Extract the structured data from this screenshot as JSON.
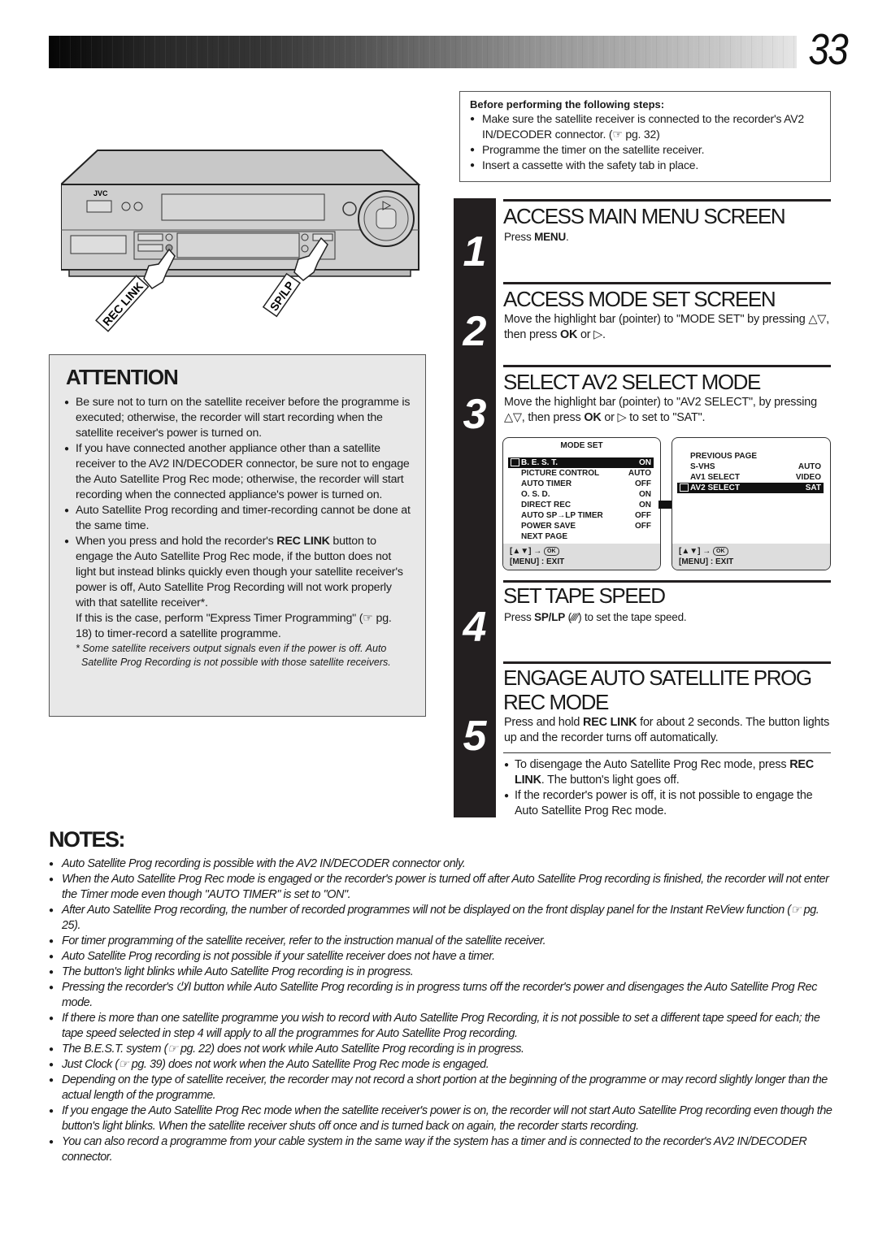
{
  "header": {
    "page_number": "33"
  },
  "illustration": {
    "brand": "JVC",
    "power_button_label": "⏻/I",
    "rec_link_label": "REC LINK",
    "sp_lp_label": "SP/LP"
  },
  "before": {
    "title": "Before performing the following steps:",
    "items": [
      "Make sure the satellite receiver is connected to the recorder's AV2 IN/DECODER connector. (☞ pg. 32)",
      "Programme the timer on the satellite receiver.",
      "Insert a cassette with the safety tab in place."
    ]
  },
  "attention": {
    "title": "ATTENTION",
    "items": [
      "Be sure not to turn on the satellite receiver before the programme is executed; otherwise, the recorder will start recording when the satellite receiver's power is turned on.",
      "If you have connected another appliance other than a satellite receiver to the AV2 IN/DECODER connector, be sure not to engage the Auto Satellite Prog Rec mode; otherwise, the recorder will start recording when the connected appliance's power is turned on.",
      "Auto Satellite Prog recording and timer-recording cannot be done at the same time."
    ],
    "item4_pre": "When you press and hold the recorder's ",
    "item4_bold": "REC LINK",
    "item4_post": " button to engage the Auto Satellite Prog Rec mode, if the button does not light but instead blinks quickly even though your satellite receiver's power is off, Auto Satellite Prog Recording will not work properly with that satellite receiver*.",
    "extra": "If this is the case, perform \"Express Timer Programming\" (☞ pg. 18) to timer-record a satellite programme.",
    "footnote": "* Some satellite receivers output signals even if the power is off. Auto Satellite Prog Recording is not possible with those satellite receivers."
  },
  "steps": [
    {
      "number": "1",
      "title": "ACCESS MAIN MENU SCREEN",
      "text_pre": "Press ",
      "text_bold": "MENU",
      "text_post": "."
    },
    {
      "number": "2",
      "title": "ACCESS MODE SET SCREEN",
      "text_pre": "Move the highlight bar (pointer) to \"MODE SET\" by pressing △▽, then press ",
      "text_bold": "OK",
      "text_post": " or ▷."
    },
    {
      "number": "3",
      "title": "SELECT AV2 SELECT MODE",
      "text_pre": "Move the highlight bar (pointer) to \"AV2 SELECT\", by pressing △▽, then press ",
      "text_bold": "OK",
      "text_post": " or ▷ to set to \"SAT\"."
    },
    {
      "number": "4",
      "title": "SET TAPE SPEED",
      "text_pre": "Press ",
      "text_bold": "SP/LP",
      "text_post": " (∕∕∕∕) to set the tape speed."
    },
    {
      "number": "5",
      "title": "ENGAGE AUTO SATELLITE PROG REC MODE",
      "text_pre": "Press and hold ",
      "text_bold": "REC LINK",
      "text_post": " for about 2 seconds. The button lights up and the recorder turns off automatically.",
      "bullet1_bold": "REC LINK",
      "bullet1_pre": "To disengage the Auto Satellite Prog Rec mode, press ",
      "bullet1_post": ". The button's light goes off.",
      "bullet2": "If the recorder's power is off, it is not possible to engage the Auto Satellite Prog Rec mode."
    }
  ],
  "osd_mode_set": {
    "title": "MODE SET",
    "rows": [
      {
        "label": "B. E. S. T.",
        "value": "ON",
        "selected": true
      },
      {
        "label": "PICTURE CONTROL",
        "value": "AUTO"
      },
      {
        "label": "AUTO TIMER",
        "value": "OFF"
      },
      {
        "label": "O. S. D.",
        "value": "ON"
      },
      {
        "label": "DIRECT REC",
        "value": "ON"
      },
      {
        "label": "AUTO SP→LP TIMER",
        "value": "OFF"
      },
      {
        "label": "POWER SAVE",
        "value": "OFF"
      },
      {
        "label": "NEXT PAGE",
        "value": ""
      }
    ],
    "footer_nav": "[▲▼] →",
    "footer_ok": "OK",
    "footer_exit": "[MENU] : EXIT"
  },
  "osd_page_two": {
    "rows": [
      {
        "label": "PREVIOUS PAGE",
        "value": ""
      },
      {
        "label": "S-VHS",
        "value": "AUTO"
      },
      {
        "label": "AV1 SELECT",
        "value": "VIDEO"
      },
      {
        "label": "AV2 SELECT",
        "value": "SAT",
        "selected": true
      }
    ],
    "footer_nav": "[▲▼] →",
    "footer_ok": "OK",
    "footer_exit": "[MENU] : EXIT"
  },
  "notes": {
    "title": "NOTES:",
    "items": [
      "Auto Satellite Prog recording is possible with the AV2 IN/DECODER connector only.",
      "When the Auto Satellite Prog Rec mode is engaged or the recorder's power is turned off after Auto Satellite Prog recording is finished, the recorder will not enter the Timer mode even though \"AUTO TIMER\" is set to \"ON\".",
      "After Auto Satellite Prog recording, the number of recorded programmes will not be displayed on the front display panel for the Instant ReView function (☞ pg. 25).",
      "For timer programming of the satellite receiver, refer to the instruction manual of the satellite receiver.",
      "Auto Satellite Prog recording is not possible if your satellite receiver does not have a timer.",
      "The button's light blinks while Auto Satellite Prog recording is in progress.",
      "Pressing the recorder's ⏻/I button while Auto Satellite Prog recording is in progress turns off the recorder's power and disengages the Auto Satellite Prog Rec mode.",
      "If there is more than one satellite programme you wish to record with Auto Satellite Prog Recording, it is not possible to set a different tape speed for each; the tape speed selected in step 4 will apply to all the programmes for Auto Satellite Prog recording.",
      "The B.E.S.T. system (☞ pg. 22) does not work while Auto Satellite Prog recording is in progress.",
      "Just Clock (☞ pg. 39) does not work when the Auto Satellite Prog Rec mode is engaged.",
      "Depending on the type of satellite receiver, the recorder may not record a short portion at the beginning of the programme or may record slightly longer than the actual length of the programme.",
      "If you engage the Auto Satellite Prog Rec mode when the satellite receiver's power is on, the recorder will not start Auto Satellite Prog recording even though the button's light blinks. When the satellite receiver shuts off once and is turned back on again, the recorder starts recording.",
      "You can also record a programme from your cable system in the same way if the system has a timer and is connected to the recorder's AV2 IN/DECODER connector."
    ]
  }
}
